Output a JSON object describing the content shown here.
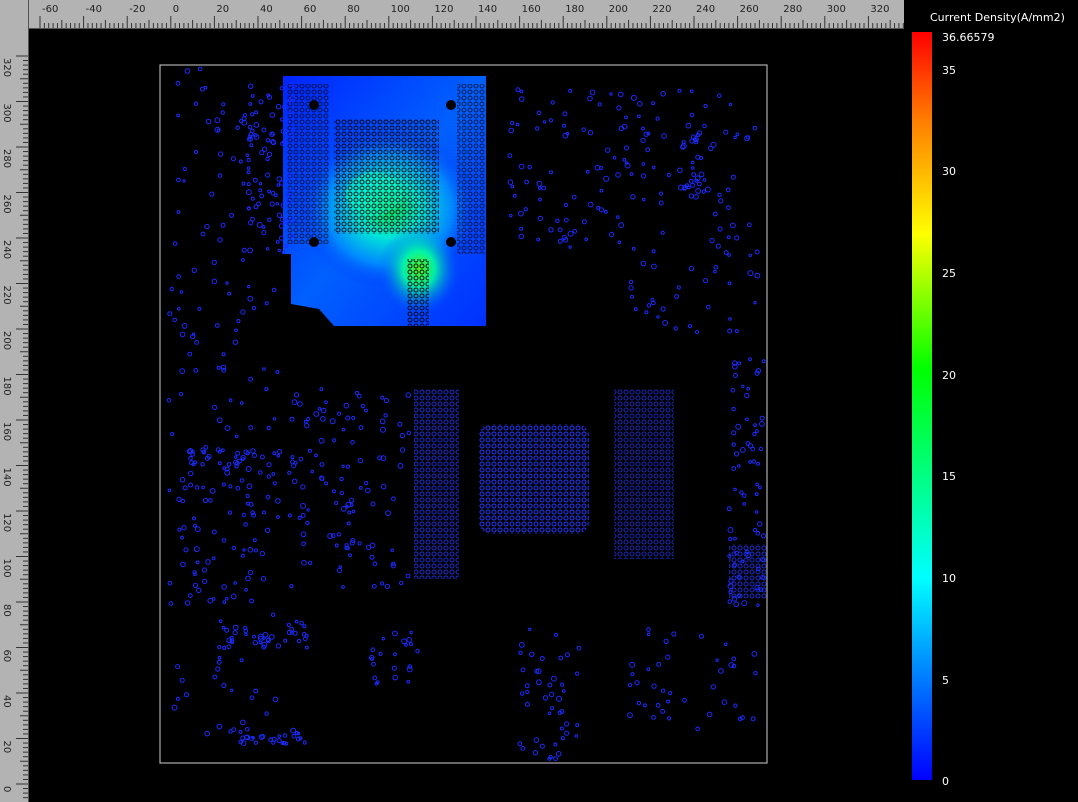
{
  "legend": {
    "title": "Current Density(A/mm2)",
    "max_label": "36.66579",
    "ticks": [
      "35",
      "30",
      "25",
      "20",
      "15",
      "10",
      "5",
      "0"
    ]
  },
  "ruler_top": {
    "labels": [
      "-60",
      "-40",
      "-20",
      "0",
      "20",
      "40",
      "60",
      "80",
      "100",
      "120",
      "140",
      "160",
      "180",
      "200",
      "220",
      "240",
      "260",
      "280",
      "300",
      "320"
    ]
  },
  "ruler_left": {
    "labels": [
      "320",
      "300",
      "280",
      "260",
      "240",
      "220",
      "200",
      "180",
      "160",
      "140",
      "120",
      "100",
      "80",
      "60",
      "40",
      "20",
      "0"
    ]
  },
  "colors": {
    "background": "#000000",
    "ruler": "#b3b3b3",
    "board_outline": "#cfcfcf",
    "via": "#1a2cff",
    "field_low": "#0000ff",
    "field_mid": "#00ffff",
    "field_high": "#00ff00",
    "field_peak": "#ff0000"
  },
  "icons": {
    "colorbar": "gradient-scale-bar"
  }
}
